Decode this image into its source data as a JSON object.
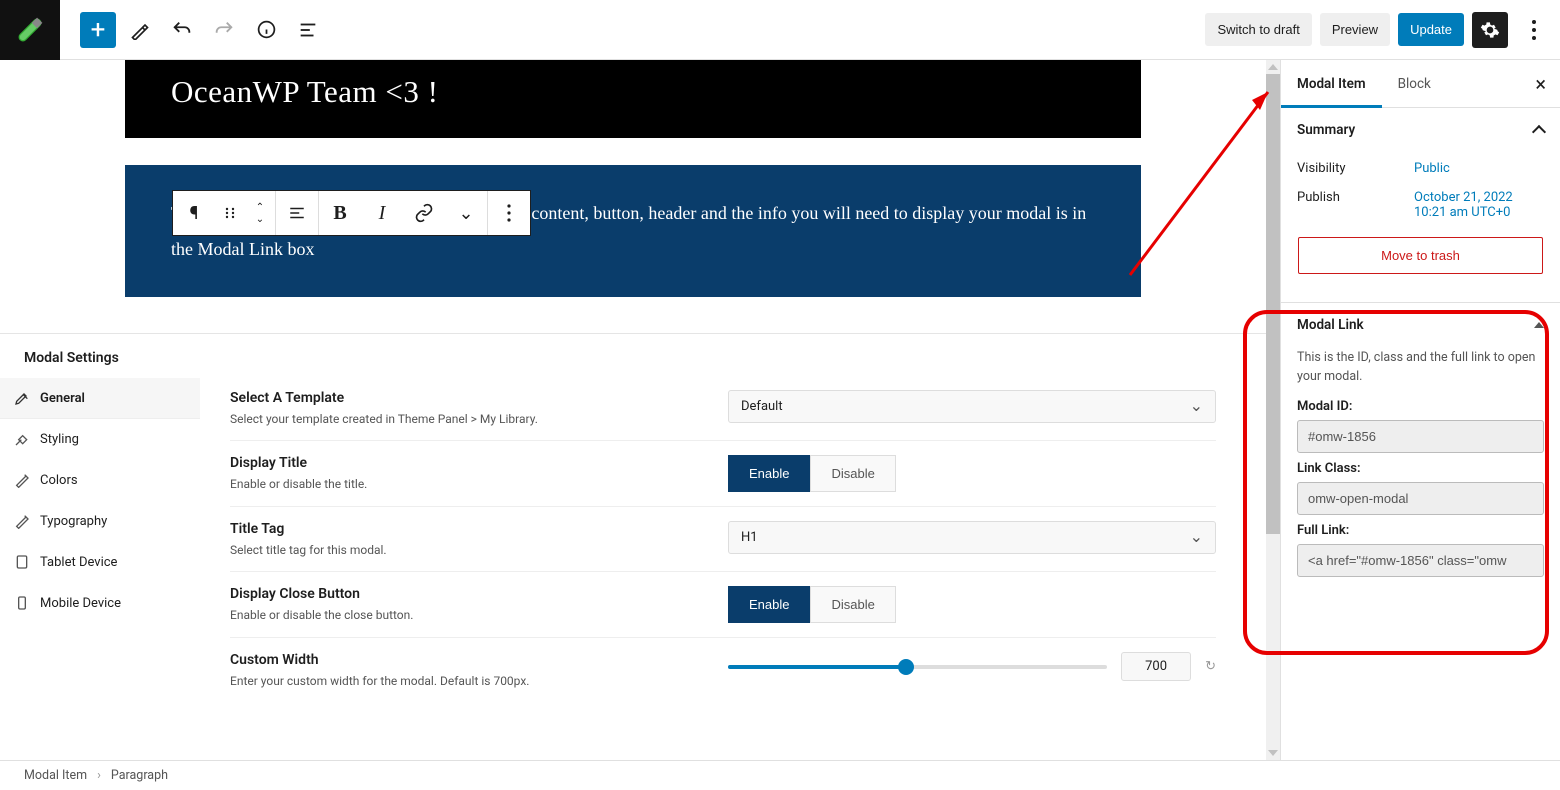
{
  "topbar": {
    "switch_draft": "Switch to draft",
    "preview": "Preview",
    "update": "Update"
  },
  "editor": {
    "heading": "OceanWP Team <3 !",
    "paragraph": "There are so many ways to add your modal to the content, button, header and the info you will need to display your modal is in the Modal Link box"
  },
  "settings": {
    "title": "Modal Settings",
    "tabs": {
      "general": "General",
      "styling": "Styling",
      "colors": "Colors",
      "typography": "Typography",
      "tablet": "Tablet Device",
      "mobile": "Mobile Device"
    },
    "template": {
      "label": "Select A Template",
      "desc": "Select your template created in Theme Panel > My Library.",
      "value": "Default"
    },
    "display_title": {
      "label": "Display Title",
      "desc": "Enable or disable the title.",
      "enable": "Enable",
      "disable": "Disable"
    },
    "title_tag": {
      "label": "Title Tag",
      "desc": "Select title tag for this modal.",
      "value": "H1"
    },
    "close_button": {
      "label": "Display Close Button",
      "desc": "Enable or disable the close button.",
      "enable": "Enable",
      "disable": "Disable"
    },
    "custom_width": {
      "label": "Custom Width",
      "desc": "Enter your custom width for the modal. Default is 700px.",
      "value": "700"
    }
  },
  "sidebar": {
    "tab_modal": "Modal Item",
    "tab_block": "Block",
    "summary": {
      "title": "Summary",
      "visibility_label": "Visibility",
      "visibility_value": "Public",
      "publish_label": "Publish",
      "publish_value": "October 21, 2022 10:21 am UTC+0",
      "trash": "Move to trash"
    },
    "modal_link": {
      "title": "Modal Link",
      "desc": "This is the ID, class and the full link to open your modal.",
      "id_label": "Modal ID:",
      "id_value": "#omw-1856",
      "class_label": "Link Class:",
      "class_value": "omw-open-modal",
      "full_label": "Full Link:",
      "full_value": "<a href=\"#omw-1856\" class=\"omw"
    }
  },
  "breadcrumb": {
    "a": "Modal Item",
    "b": "Paragraph"
  }
}
